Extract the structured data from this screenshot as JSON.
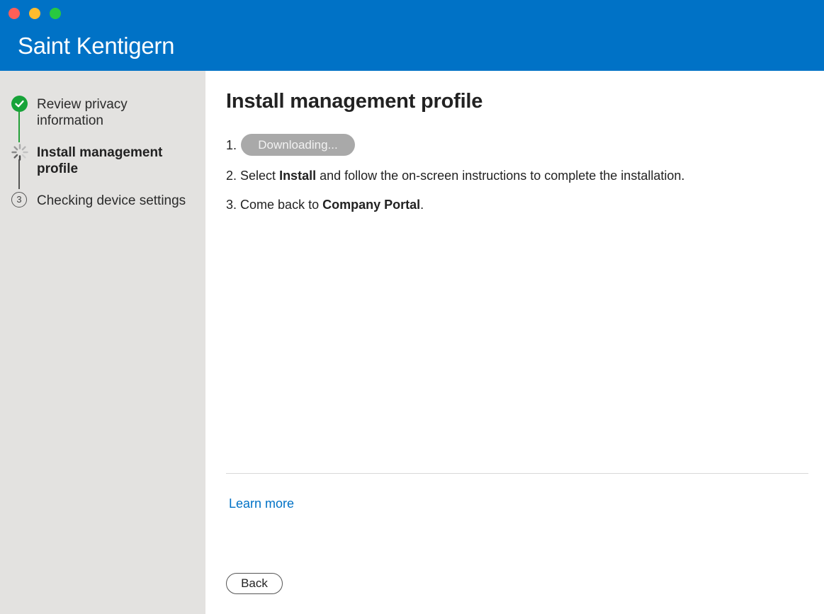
{
  "window": {
    "title": "Saint Kentigern",
    "controls": [
      "close",
      "minimize",
      "maximize"
    ]
  },
  "sidebar": {
    "steps": [
      {
        "label": "Review privacy information",
        "status": "complete",
        "icon": "checkmark-icon"
      },
      {
        "label": "Install management profile",
        "status": "in-progress",
        "icon": "spinner-icon"
      },
      {
        "label": "Checking device settings",
        "status": "pending",
        "number": "3"
      }
    ]
  },
  "main": {
    "title": "Install management profile",
    "instructions": {
      "step1_number": "1.",
      "download_button": "Downloading...",
      "step2_number": "2.",
      "step2_pre": "Select ",
      "step2_bold": "Install",
      "step2_post": " and follow the on-screen instructions to complete the installation.",
      "step3_number": "3.",
      "step3_pre": "Come back to ",
      "step3_bold": "Company Portal",
      "step3_post": "."
    },
    "learn_more": "Learn more",
    "back_button": "Back"
  },
  "colors": {
    "header": "#0072c6",
    "sidebar": "#e3e2e0",
    "complete": "#17a339",
    "link": "#0072c6",
    "disabled_button": "#a9a9a9"
  }
}
